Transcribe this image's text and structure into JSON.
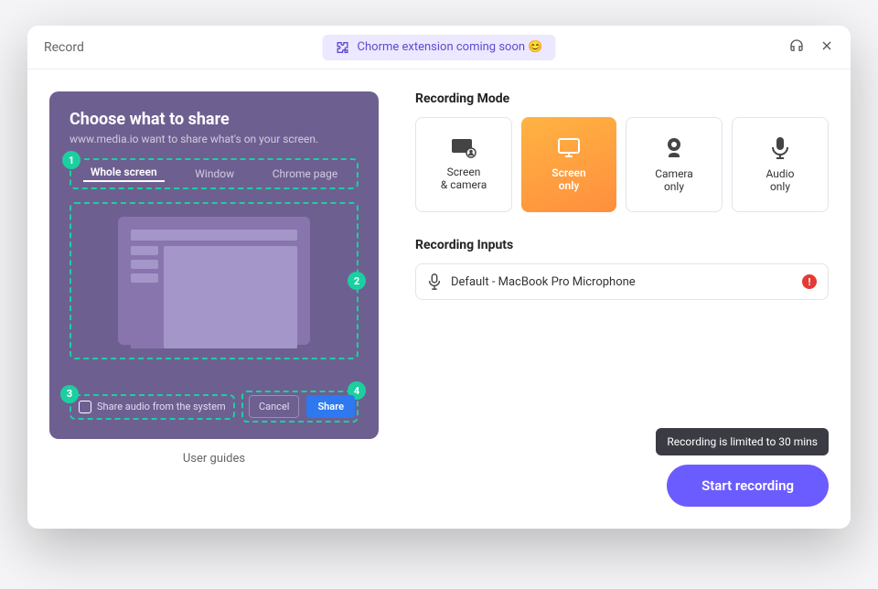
{
  "title": "Record",
  "banner": "Chorme extension coming soon 😊",
  "share": {
    "title": "Choose what to share",
    "subtitle": "www.media.io want to share what's on your screen.",
    "tabs": [
      "Whole screen",
      "Window",
      "Chrome page"
    ],
    "audio": "Share audio from the system",
    "cancel": "Cancel",
    "shareBtn": "Share",
    "badges": [
      "1",
      "2",
      "3",
      "4"
    ]
  },
  "guides": "User guides",
  "recordingMode": {
    "title": "Recording Mode",
    "items": [
      {
        "label": "Screen\n& camera"
      },
      {
        "label": "Screen\nonly"
      },
      {
        "label": "Camera\nonly"
      },
      {
        "label": "Audio\nonly"
      }
    ]
  },
  "inputs": {
    "title": "Recording Inputs",
    "device": "Default - MacBook Pro Microphone",
    "warn": "!"
  },
  "tooltip": "Recording is limited to 30 mins",
  "start": "Start recording"
}
